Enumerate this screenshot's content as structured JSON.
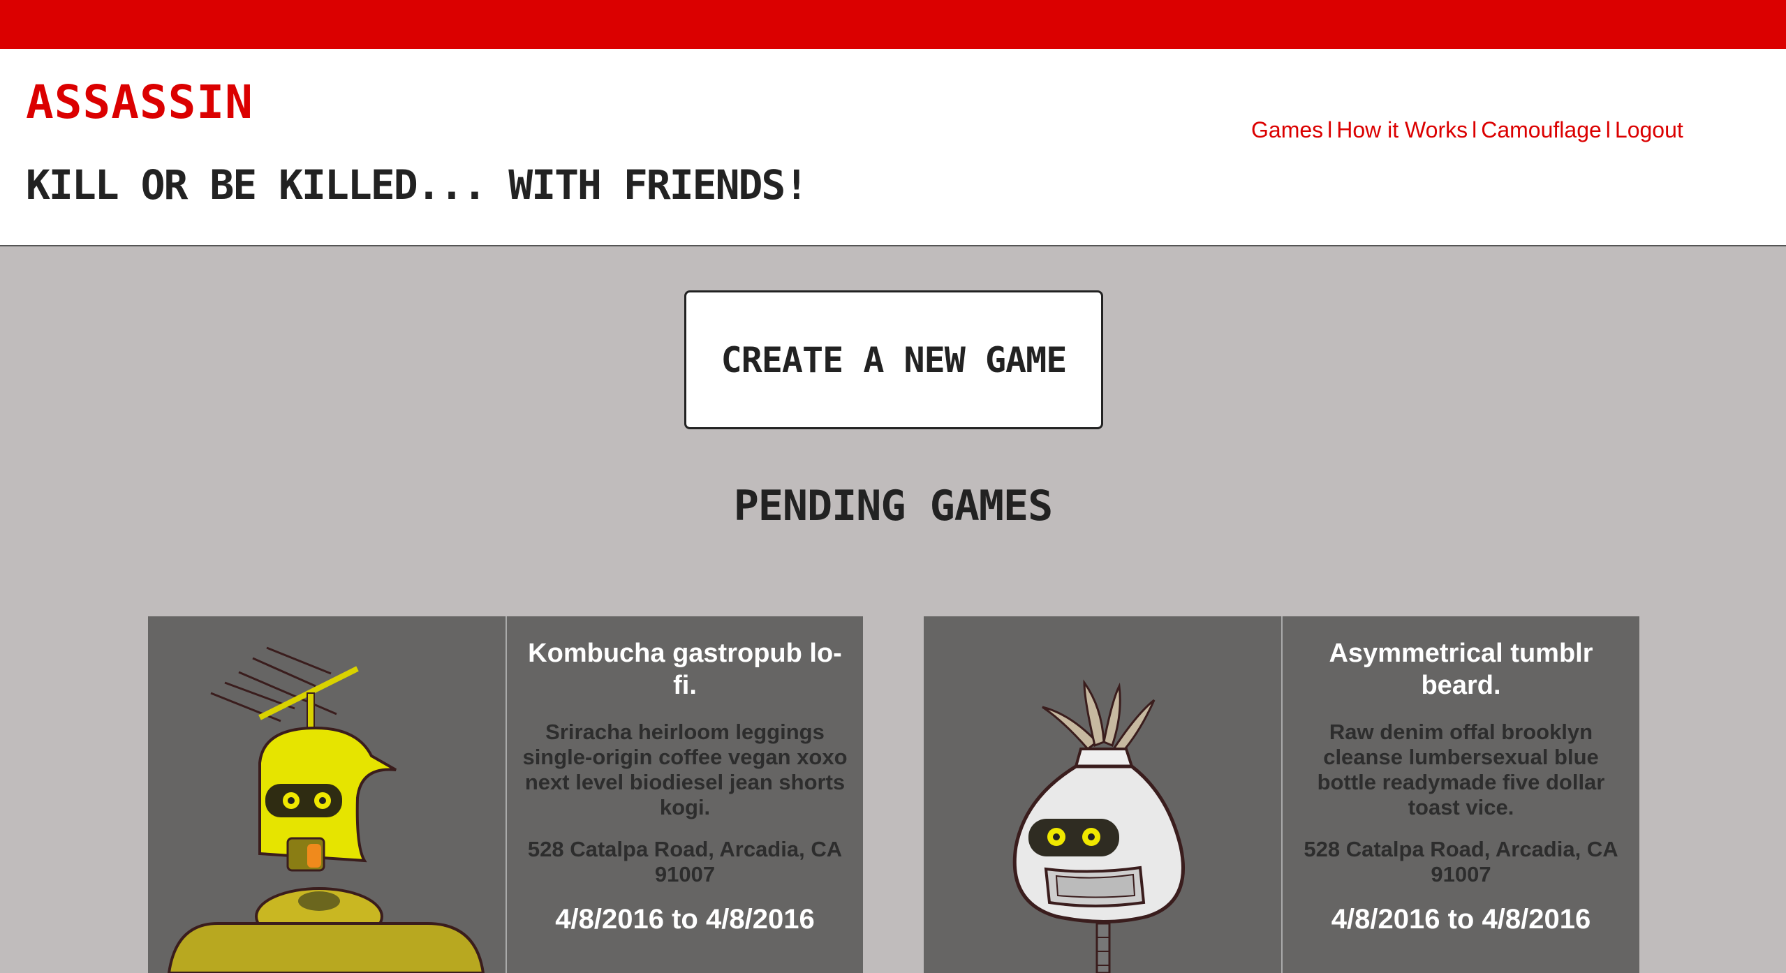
{
  "header": {
    "logo": "ASSASSIN",
    "tagline": "KILL OR BE KILLED... WITH FRIENDS!",
    "nav": [
      {
        "label": "Games"
      },
      {
        "label": "How it Works"
      },
      {
        "label": "Camouflage"
      },
      {
        "label": "Logout"
      }
    ],
    "nav_separator": "l"
  },
  "main": {
    "create_button": "CREATE A NEW GAME",
    "section_title": "PENDING GAMES",
    "games": [
      {
        "avatar_icon": "yellow-robot-antenna",
        "title": "Kombucha gastropub lo-fi.",
        "description": "Sriracha heirloom leggings single-origin coffee vegan xoxo next level biodiesel jean shorts kogi.",
        "address": "528 Catalpa Road, Arcadia, CA 91007",
        "dates": "4/8/2016 to 4/8/2016"
      },
      {
        "avatar_icon": "white-robot-mohawk",
        "title": "Asymmetrical tumblr beard.",
        "description": "Raw denim offal brooklyn cleanse lumbersexual blue bottle readymade five dollar toast vice.",
        "address": "528 Catalpa Road, Arcadia, CA 91007",
        "dates": "4/8/2016 to 4/8/2016"
      }
    ]
  },
  "colors": {
    "brand_red": "#db0000",
    "page_bg": "#c0bcbc",
    "card_bg": "#666564",
    "text_dark": "#222222"
  }
}
